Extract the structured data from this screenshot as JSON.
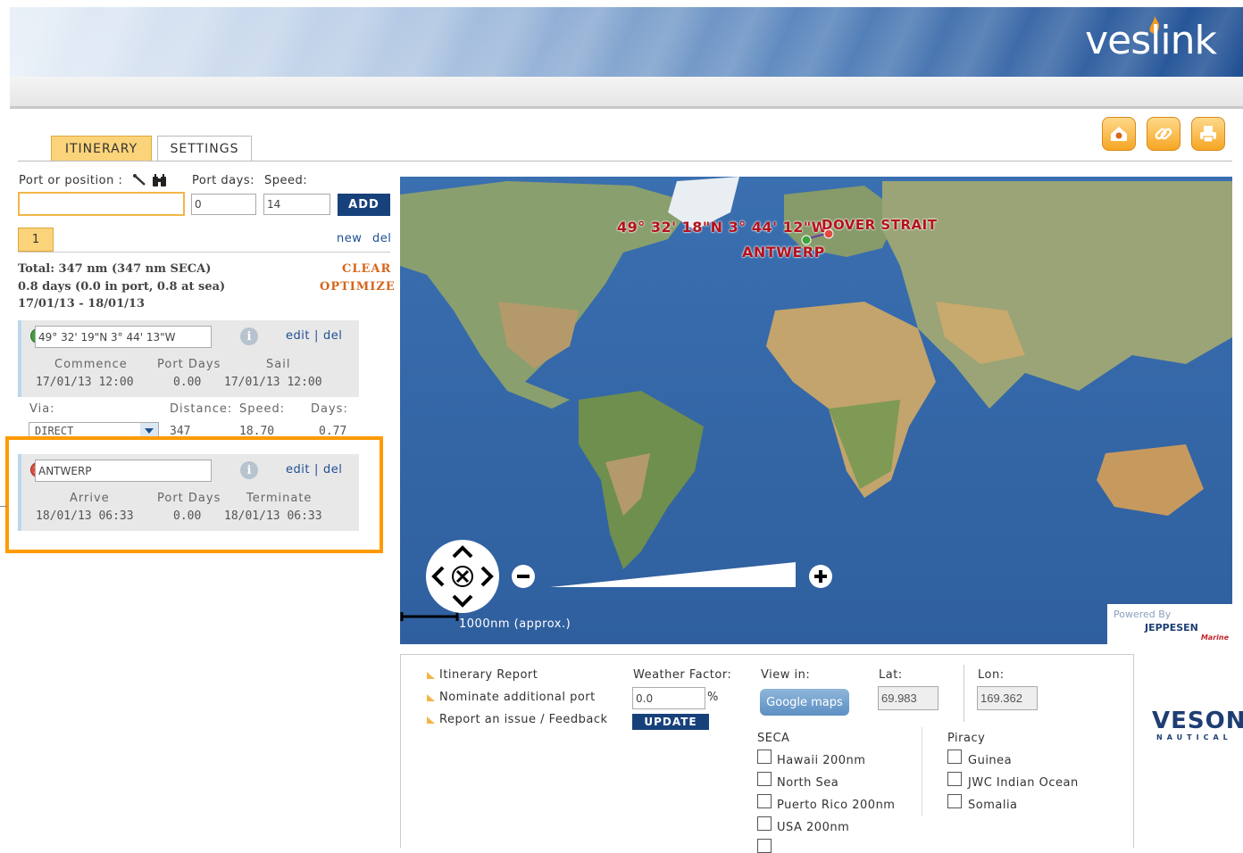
{
  "brand": {
    "name": "veslink"
  },
  "tabs": [
    {
      "label": "ITINERARY",
      "active": true
    },
    {
      "label": "SETTINGS",
      "active": false
    }
  ],
  "top_icons": [
    "home-map-icon",
    "link-icon",
    "print-icon"
  ],
  "add_form": {
    "port_label": "Port or position :",
    "port_value": "",
    "port_days_label": "Port days:",
    "port_days_value": "0",
    "speed_label": "Speed:",
    "speed_value": "14",
    "add_label": "ADD"
  },
  "route": {
    "tab_label": "1",
    "new_label": "new",
    "del_label": "del",
    "summary_1": "Total: 347 nm (347 nm SECA)",
    "summary_2": "0.8 days (0.0 in port, 0.8 at sea)",
    "summary_3": "17/01/13 - 18/01/13",
    "clear_label": "CLEAR",
    "optimize_label": "OPTIMIZE"
  },
  "stops": [
    {
      "position": "49° 32' 19\"N 3° 44' 13\"W",
      "status": "start",
      "edit": "edit",
      "sep": "|",
      "del": "del",
      "col1_h": "Commence",
      "col2_h": "Port Days",
      "col3_h": "Sail",
      "col1_v": "17/01/13 12:00",
      "col2_v": "0.00",
      "col3_v": "17/01/13 12:00"
    },
    {
      "position": "ANTWERP",
      "status": "end",
      "edit": "edit",
      "sep": "|",
      "del": "del",
      "col1_h": "Arrive",
      "col2_h": "Port Days",
      "col3_h": "Terminate",
      "col1_v": "18/01/13 06:33",
      "col2_v": "0.00",
      "col3_v": "18/01/13 06:33"
    }
  ],
  "leg": {
    "via_label": "Via:",
    "distance_label": "Distance:",
    "speed_label": "Speed:",
    "days_label": "Days:",
    "via_value": "DIRECT",
    "distance_value": "347",
    "speed_value": "18.70",
    "days_value": "0.77"
  },
  "map": {
    "label_position": "49° 32' 18\"N 3° 44' 12\"W",
    "label_strait": "DOVER STRAIT",
    "label_port": "ANTWERP",
    "scale_text": "1000nm (approx.)",
    "powered_by": "Powered By",
    "provider": "JEPPESEN",
    "provider_sub": "Marine"
  },
  "bottom": {
    "links": [
      "Itinerary Report",
      "Nominate additional port",
      "Report an issue / Feedback"
    ],
    "weather_label": "Weather Factor:",
    "weather_value": "0.0",
    "percent": "%",
    "update_label": "UPDATE",
    "view_in_label": "View in:",
    "google_label": "Google maps",
    "lat_label": "Lat:",
    "lat_value": "69.983",
    "lon_label": "Lon:",
    "lon_value": "169.362",
    "seca_label": "SECA",
    "seca_items": [
      "Hawaii 200nm",
      "North Sea",
      "Puerto Rico 200nm",
      "USA 200nm"
    ],
    "piracy_label": "Piracy",
    "piracy_items": [
      "Guinea",
      "JWC Indian Ocean",
      "Somalia"
    ]
  },
  "vendor": {
    "name": "VESON",
    "sub": "NAUTICAL"
  },
  "colors": {
    "accent": "#fbd37a",
    "navy": "#17417b",
    "highlight": "#ff9a00",
    "route_red": "#b4121b"
  }
}
